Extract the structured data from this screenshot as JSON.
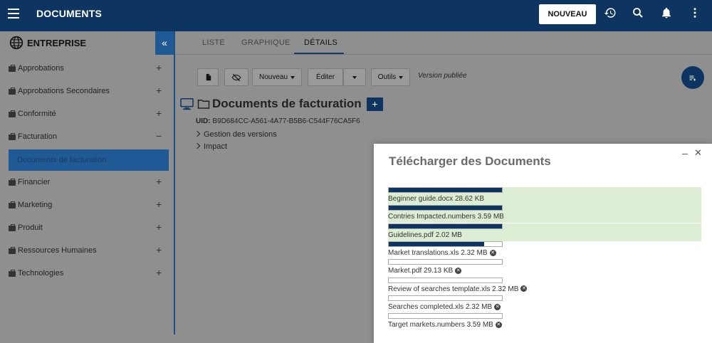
{
  "app": {
    "title": "DOCUMENTS"
  },
  "header": {
    "new_button": "NOUVEAU"
  },
  "sidebar": {
    "title": "ENTREPRISE",
    "collapse_glyph": "«",
    "items": [
      {
        "label": "Approbations",
        "toggle": "+"
      },
      {
        "label": "Approbations Secondaires",
        "toggle": "+"
      },
      {
        "label": "Conformité",
        "toggle": "+"
      },
      {
        "label": "Facturation",
        "toggle": "−"
      },
      {
        "label": "Financier",
        "toggle": "+"
      },
      {
        "label": "Marketing",
        "toggle": "+"
      },
      {
        "label": "Produit",
        "toggle": "+"
      },
      {
        "label": "Ressources Humaines",
        "toggle": "+"
      },
      {
        "label": "Technologies",
        "toggle": "+"
      }
    ],
    "selected_sub": "Documents de facturation"
  },
  "tabs": [
    {
      "label": "LISTE"
    },
    {
      "label": "GRAPHIQUE"
    },
    {
      "label": "DÉTAILS"
    }
  ],
  "toolbar": {
    "new_label": "Nouveau",
    "edit_label": "Éditer",
    "tools_label": "Outils",
    "version_status": "Version publiée"
  },
  "document": {
    "title": "Documents de facturation",
    "uid_label": "UID:",
    "uid_value": "B9D684CC-A561-4A77-B5B6-C544F76CA5F6",
    "tree": [
      "Gestion des versions",
      "Impact"
    ]
  },
  "upload_panel": {
    "title": "Télécharger des Documents",
    "files": [
      {
        "name": "Beginner guide.docx 28.62 KB",
        "progress": 1.0,
        "done": true
      },
      {
        "name": "Contries Impacted.numbers 3.59 MB",
        "progress": 1.0,
        "done": true
      },
      {
        "name": "Guidelines.pdf 2.02 MB",
        "progress": 1.0,
        "done": true
      },
      {
        "name": "Market translations.xls 2.32 MB",
        "progress": 0.84,
        "done": false
      },
      {
        "name": "Market.pdf 29.13 KB",
        "progress": 0,
        "done": false
      },
      {
        "name": "Review of searches template.xls 2.32 MB",
        "progress": 0,
        "done": false
      },
      {
        "name": "Searches completed.xls 2.32 MB",
        "progress": 0,
        "done": false
      },
      {
        "name": "Target markets.numbers 3.59 MB",
        "progress": 0,
        "done": false
      }
    ]
  },
  "colors": {
    "primary": "#0e3561",
    "accent": "#1f5a94",
    "done_row": "#dcedd3"
  },
  "icons": [
    "menu-icon",
    "history-icon",
    "search-icon",
    "bell-icon",
    "more-vert-icon",
    "globe-icon",
    "briefcase-icon",
    "document-icon",
    "visibility-off-icon",
    "monitor-icon",
    "folder-icon",
    "plus-icon",
    "close-icon",
    "minimize-icon",
    "cancel-icon"
  ]
}
